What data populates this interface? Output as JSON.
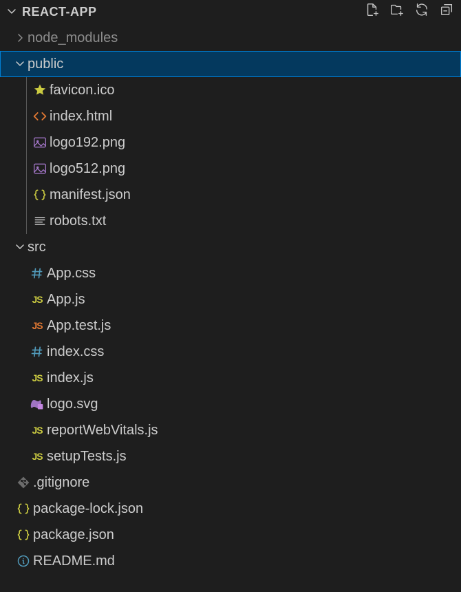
{
  "header": {
    "title": "REACT-APP"
  },
  "tree": {
    "node_modules": "node_modules",
    "public": "public",
    "public_children": {
      "favicon": "favicon.ico",
      "index_html": "index.html",
      "logo192": "logo192.png",
      "logo512": "logo512.png",
      "manifest": "manifest.json",
      "robots": "robots.txt"
    },
    "src": "src",
    "src_children": {
      "app_css": "App.css",
      "app_js": "App.js",
      "app_test": "App.test.js",
      "index_css": "index.css",
      "index_js": "index.js",
      "logo_svg": "logo.svg",
      "report": "reportWebVitals.js",
      "setup": "setupTests.js"
    },
    "gitignore": ".gitignore",
    "pkg_lock": "package-lock.json",
    "pkg": "package.json",
    "readme": "README.md"
  }
}
